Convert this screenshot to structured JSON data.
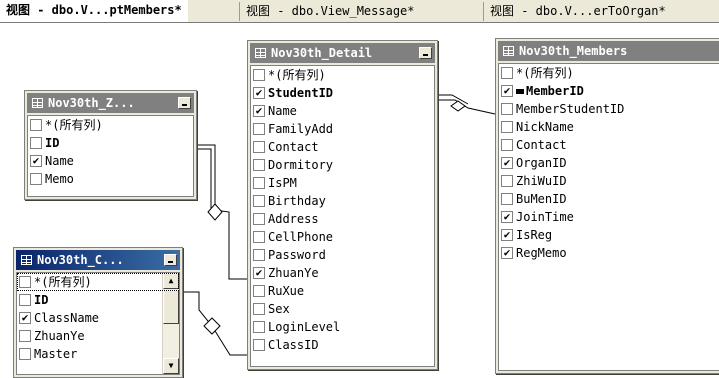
{
  "tabs": [
    {
      "label": "视图 - dbo.V...ptMembers*",
      "active": true
    },
    {
      "label": "视图 - dbo.View_Message*",
      "active": false
    },
    {
      "label": "视图 - dbo.V...erToOrgan*",
      "active": false
    }
  ],
  "tables": {
    "zhiwu": {
      "title": "Nov30th_Z...",
      "columns": [
        {
          "name": "*(所有列)",
          "checked": false,
          "pk": false
        },
        {
          "name": "ID",
          "checked": false,
          "pk": true
        },
        {
          "name": "Name",
          "checked": true,
          "pk": false
        },
        {
          "name": "Memo",
          "checked": false,
          "pk": false
        }
      ]
    },
    "classes": {
      "title": "Nov30th_C...",
      "columns": [
        {
          "name": "*(所有列)",
          "checked": false,
          "pk": false
        },
        {
          "name": "ID",
          "checked": false,
          "pk": true
        },
        {
          "name": "ClassName",
          "checked": true,
          "pk": false
        },
        {
          "name": "ZhuanYe",
          "checked": false,
          "pk": false
        },
        {
          "name": "Master",
          "checked": false,
          "pk": false
        }
      ]
    },
    "detail": {
      "title": "Nov30th_Detail",
      "columns": [
        {
          "name": "*(所有列)",
          "checked": false,
          "pk": false
        },
        {
          "name": "StudentID",
          "checked": true,
          "pk": true
        },
        {
          "name": "Name",
          "checked": true,
          "pk": false
        },
        {
          "name": "FamilyAdd",
          "checked": false,
          "pk": false
        },
        {
          "name": "Contact",
          "checked": false,
          "pk": false
        },
        {
          "name": "Dormitory",
          "checked": false,
          "pk": false
        },
        {
          "name": "IsPM",
          "checked": false,
          "pk": false
        },
        {
          "name": "Birthday",
          "checked": false,
          "pk": false
        },
        {
          "name": "Address",
          "checked": false,
          "pk": false
        },
        {
          "name": "CellPhone",
          "checked": false,
          "pk": false
        },
        {
          "name": "Password",
          "checked": false,
          "pk": false
        },
        {
          "name": "ZhuanYe",
          "checked": true,
          "pk": false
        },
        {
          "name": "RuXue",
          "checked": false,
          "pk": false
        },
        {
          "name": "Sex",
          "checked": false,
          "pk": false
        },
        {
          "name": "LoginLevel",
          "checked": false,
          "pk": false
        },
        {
          "name": "ClassID",
          "checked": false,
          "pk": false
        }
      ]
    },
    "members": {
      "title": "Nov30th_Members",
      "columns": [
        {
          "name": "*(所有列)",
          "checked": false,
          "pk": false
        },
        {
          "name": "MemberID",
          "checked": true,
          "pk": true,
          "key": true
        },
        {
          "name": "MemberStudentID",
          "checked": false,
          "pk": false
        },
        {
          "name": "NickName",
          "checked": false,
          "pk": false
        },
        {
          "name": "Contact",
          "checked": false,
          "pk": false
        },
        {
          "name": "OrganID",
          "checked": true,
          "pk": false
        },
        {
          "name": "ZhiWuID",
          "checked": false,
          "pk": false
        },
        {
          "name": "BuMenID",
          "checked": false,
          "pk": false
        },
        {
          "name": "JoinTime",
          "checked": true,
          "pk": false
        },
        {
          "name": "IsReg",
          "checked": true,
          "pk": false
        },
        {
          "name": "RegMemo",
          "checked": true,
          "pk": false
        }
      ]
    }
  },
  "icons": {
    "check": "✔",
    "table": "table-icon",
    "scroll_up": "▲",
    "scroll_down": "▼"
  }
}
